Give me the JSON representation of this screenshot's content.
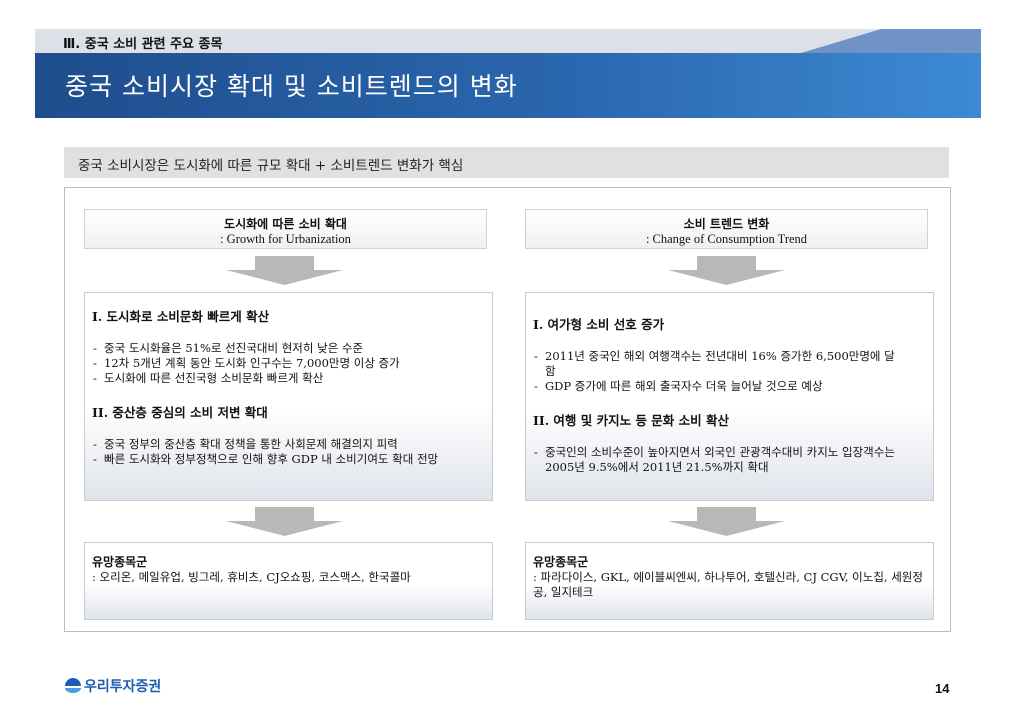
{
  "header": {
    "section_label": "Ⅲ. 중국 소비 관련 주요 종목",
    "title": "중국 소비시장 확대 및 소비트렌드의 변화"
  },
  "summary": "중국 소비시장은 도시화에 따른 규모 확대 + 소비트렌드 변화가 핵심",
  "left": {
    "head_line1": "도시화에 따른 소비 확대",
    "head_line2": ": Growth for Urbanization",
    "sections": [
      {
        "heading": "I. 도시화로 소비문화 빠르게 확산",
        "items": [
          "중국 도시화율은 51%로 선진국대비 현저히 낮은 수준",
          "12차 5개년 계획 동안 도시화 인구수는 7,000만명 이상 증가",
          "도시화에 따른 선진국형 소비문화 빠르게 확산"
        ]
      },
      {
        "heading": "II. 중산층 중심의 소비 저변 확대",
        "items": [
          "중국 정부의 중산층 확대 정책을 통한 사회문제 해결의지 피력",
          "빠른 도시화와 정부정책으로 인해 향후 GDP 내 소비기여도 확대 전망"
        ]
      }
    ],
    "stocks_title": "유망종목군",
    "stocks_text": ": 오리온, 메일유업, 빙그레, 휴비츠, CJ오쇼핑, 코스맥스, 한국콜마"
  },
  "right": {
    "head_line1": "소비 트렌드 변화",
    "head_line2": ": Change of Consumption Trend",
    "sections": [
      {
        "heading": "I. 여가형 소비 선호 증가",
        "items": [
          "2011년 중국인 해외 여행객수는 전년대비 16% 증가한 6,500만명에 달함",
          "GDP 증가에 따른 해외 출국자수 더욱 늘어날 것으로 예상"
        ]
      },
      {
        "heading": "II. 여행 및 카지노 등 문화 소비 확산",
        "items": [
          "중국인의 소비수준이 높아지면서 외국인 관광객수대비 카지노 입장객수는 2005년 9.5%에서 2011년 21.5%까지 확대"
        ]
      }
    ],
    "stocks_title": "유망종목군",
    "stocks_text": ": 파라다이스, GKL, 에이블씨엔씨, 하나투어, 호텔신라, CJ CGV, 이노칩, 세원정공, 일지테크"
  },
  "footer": {
    "logo_text": "우리투자증권",
    "page_number": "14"
  },
  "colors": {
    "title_bar": "#2a66ad",
    "section_bar": "#dde0e6",
    "logo": "#1c5db0"
  }
}
